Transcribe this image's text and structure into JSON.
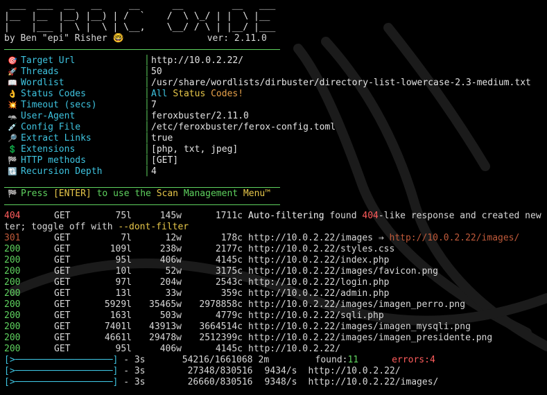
{
  "banner": [
    " ___  ___  __   __     __      __         __   ___",
    "|__  |__  |__) |__) | /  `    /  \\ \\_/ | |  \\ |__",
    "|    |___ |  \\ |  \\ | \\__,    \\__/ / \\ | |__/ |___"
  ],
  "byline": {
    "author": "by Ben \"epi\" Risher 🤓",
    "version": "ver: 2.11.0"
  },
  "config": [
    {
      "icon": "🎯",
      "iconName": "target-icon",
      "label": "Target Url",
      "value": "http://10.0.2.22/"
    },
    {
      "icon": "🚀",
      "iconName": "rocket-icon",
      "label": "Threads",
      "value": "50"
    },
    {
      "icon": "📖",
      "iconName": "book-icon",
      "label": "Wordlist",
      "value": "/usr/share/wordlists/dirbuster/directory-list-lowercase-2.3-medium.txt"
    },
    {
      "icon": "👌",
      "iconName": "ok-hand-icon",
      "label": "Status Codes",
      "value": "",
      "special": "status"
    },
    {
      "icon": "💥",
      "iconName": "explosion-icon",
      "label": "Timeout (secs)",
      "value": "7"
    },
    {
      "icon": "🦡",
      "iconName": "badger-icon",
      "label": "User-Agent",
      "value": "feroxbuster/2.11.0"
    },
    {
      "icon": "💉",
      "iconName": "syringe-icon",
      "label": "Config File",
      "value": "/etc/feroxbuster/ferox-config.toml"
    },
    {
      "icon": "🔎",
      "iconName": "magnifier-icon",
      "label": "Extract Links",
      "value": "true"
    },
    {
      "icon": "💲",
      "iconName": "dollar-icon",
      "label": "Extensions",
      "value": "[php, txt, jpeg]"
    },
    {
      "icon": "🏁",
      "iconName": "checkered-flag-icon",
      "label": "HTTP methods",
      "value": "[GET]"
    },
    {
      "icon": "🔃",
      "iconName": "recursion-icon",
      "label": "Recursion Depth",
      "value": "4"
    }
  ],
  "statusCodes": {
    "all": "All",
    "status": "Status",
    "codes": "Codes!"
  },
  "menu": {
    "icon": "🏁",
    "press": "Press ",
    "enter": "[ENTER]",
    "mid": " to use the ",
    "scan": "Scan ",
    "mgmt": "Management ",
    "menu": "Menu™"
  },
  "autofilter": {
    "status": "404",
    "method": "GET",
    "lines": "75l",
    "words": "145w",
    "chars": "1711c",
    "msgA": "Auto-filtering",
    "msgB": " found ",
    "msgCode": "404",
    "msgC": "-like response and created new",
    "wrap1": "ter; toggle off with ",
    "flag": "--dont-filter"
  },
  "results": [
    {
      "status": "301",
      "method": "GET",
      "lines": "7l",
      "words": "12w",
      "chars": "178c",
      "url": "http://10.0.2.22/images",
      "redirect": "http://10.0.2.22/images/"
    },
    {
      "status": "200",
      "method": "GET",
      "lines": "109l",
      "words": "238w",
      "chars": "2177c",
      "url": "http://10.0.2.22/styles.css"
    },
    {
      "status": "200",
      "method": "GET",
      "lines": "95l",
      "words": "406w",
      "chars": "4145c",
      "url": "http://10.0.2.22/index.php"
    },
    {
      "status": "200",
      "method": "GET",
      "lines": "10l",
      "words": "52w",
      "chars": "3175c",
      "url": "http://10.0.2.22/images/favicon.png"
    },
    {
      "status": "200",
      "method": "GET",
      "lines": "97l",
      "words": "204w",
      "chars": "2543c",
      "url": "http://10.0.2.22/login.php"
    },
    {
      "status": "200",
      "method": "GET",
      "lines": "13l",
      "words": "33w",
      "chars": "359c",
      "url": "http://10.0.2.22/admin.php"
    },
    {
      "status": "200",
      "method": "GET",
      "lines": "5929l",
      "words": "35465w",
      "chars": "2978858c",
      "url": "http://10.0.2.22/images/imagen_perro.png"
    },
    {
      "status": "200",
      "method": "GET",
      "lines": "163l",
      "words": "503w",
      "chars": "4779c",
      "url": "http://10.0.2.22/sqli.php"
    },
    {
      "status": "200",
      "method": "GET",
      "lines": "7401l",
      "words": "43913w",
      "chars": "3664514c",
      "url": "http://10.0.2.22/images/imagen_mysqli.png"
    },
    {
      "status": "200",
      "method": "GET",
      "lines": "4661l",
      "words": "29478w",
      "chars": "2512399c",
      "url": "http://10.0.2.22/images/imagen_presidente.png"
    },
    {
      "status": "200",
      "method": "GET",
      "lines": "95l",
      "words": "406w",
      "chars": "4145c",
      "url": "http://10.0.2.22/"
    }
  ],
  "progress": [
    {
      "bar": "[>──────────────────]",
      "time": " - 3s",
      "count": "54216/1661068",
      "rate": "2m",
      "foundLabel": "found:",
      "found": "11",
      "errorsLabel": "errors:",
      "errors": "4"
    },
    {
      "bar": "[>──────────────────]",
      "time": " - 3s",
      "count": "27348/830516",
      "rate": "9434/s",
      "url": "http://10.0.2.22/"
    },
    {
      "bar": "[>──────────────────]",
      "time": " - 3s",
      "count": "26660/830516",
      "rate": "9348/s",
      "url": "http://10.0.2.22/images/"
    }
  ]
}
